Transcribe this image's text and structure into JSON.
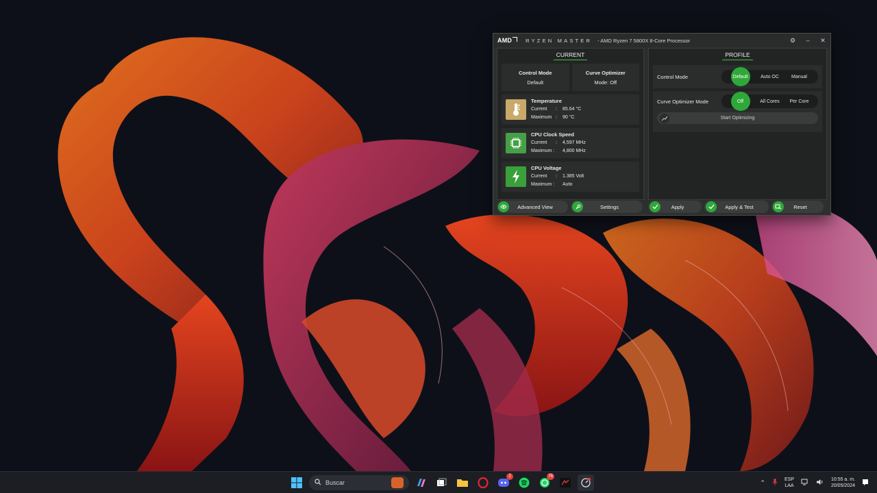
{
  "window": {
    "logo": "AMD",
    "brand": "RYZEN MASTER",
    "title": "-  AMD Ryzen 7 5800X 8-Core Processor",
    "controls": [
      "settings-icon",
      "minimize-icon",
      "close-icon"
    ]
  },
  "current": {
    "header": "CURRENT",
    "control_mode": {
      "label": "Control Mode",
      "value": "Default"
    },
    "curve_optimizer": {
      "label": "Curve Optimizer",
      "value": "Mode:  Off"
    },
    "temperature": {
      "title": "Temperature",
      "current_key": "Current",
      "current_val": "85.64  °C",
      "max_key": "Maximum",
      "max_val": "90  °C",
      "icon": "thermometer-icon"
    },
    "clock": {
      "title": "CPU Clock Speed",
      "current_key": "Current",
      "current_val": "4,597  MHz",
      "max_key": "Maximum :",
      "max_val": "4,800  MHz",
      "icon": "cpu-chip-icon"
    },
    "voltage": {
      "title": "CPU Voltage",
      "current_key": "Current",
      "current_val": "1.385  Volt",
      "max_key": "Maximum :",
      "max_val": "Auto",
      "icon": "lightning-icon"
    }
  },
  "profile": {
    "header": "PROFILE",
    "control_mode": {
      "label": "Control Mode",
      "options": [
        "Default",
        "Auto OC",
        "Manual"
      ],
      "selected": "Default"
    },
    "curve_mode": {
      "label": "Curve Optimizer Mode",
      "options": [
        "Off",
        "All Cores",
        "Per Core"
      ],
      "selected": "Off"
    },
    "start_optimizing": "Start Optimizing"
  },
  "footer": {
    "advanced_view": "Advanced View",
    "settings": "Settings",
    "apply": "Apply",
    "apply_test": "Apply & Test",
    "reset": "Reset"
  },
  "taskbar": {
    "search_placeholder": "Buscar",
    "discord_badge": "2",
    "whatsapp_badge": "76",
    "lang_line1": "ESP",
    "lang_line2": "LAA",
    "time": "10:55 a. m.",
    "date": "20/05/2024"
  },
  "colors": {
    "accent_green": "#2fa83a",
    "panel": "#222424",
    "taskbar": "#1c1e24"
  }
}
